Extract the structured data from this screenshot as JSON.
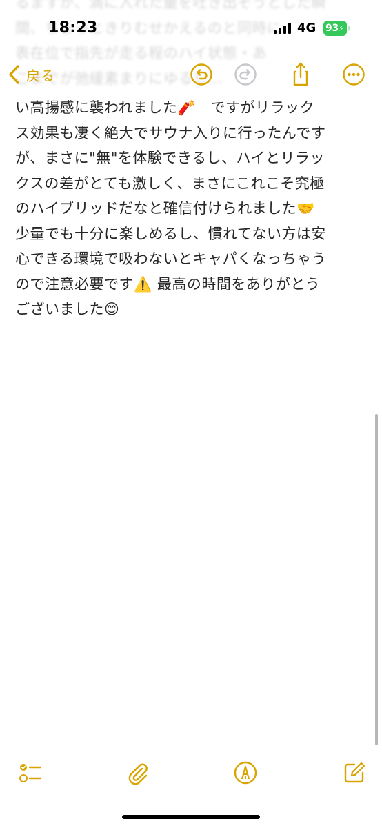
{
  "status_bar": {
    "time": "18:23",
    "network": "4G",
    "battery": "93"
  },
  "nav": {
    "back_label": "戻る",
    "icons": [
      "undo-icon",
      "redo-icon",
      "share-icon",
      "more-icon"
    ]
  },
  "colors": {
    "accent": "#d9a400",
    "battery_green": "#34c759",
    "text": "#262626"
  },
  "ghost_text": "るますが、満に入れた量を吐き出そうとした瞬\n間、ちょっときりむせかえるのと同時に\n表在位で指先が走る程のハイ状態・あ\nこまでが弛緩素まりにゆるし...",
  "note": {
    "body": "い高揚感に襲われました🧨　ですがリラック\nス効果も凄く絶大でサウナ入りに行ったんです\nが、まさに\"無\"を体験できるし、ハイとリラッ\nクスの差がとても激しく、まさにこれこそ究極\nのハイブリッドだなと確信付けられました🤝\n少量でも十分に楽しめるし、慣れてない方は安\n心できる環境で吸わないとキャパくなっちゃう\nので注意必要です⚠️ 最高の時間をありがとう\nございました😊"
  },
  "toolbar": {
    "icons": [
      "checklist-icon",
      "attachment-icon",
      "markup-icon",
      "compose-icon"
    ]
  }
}
